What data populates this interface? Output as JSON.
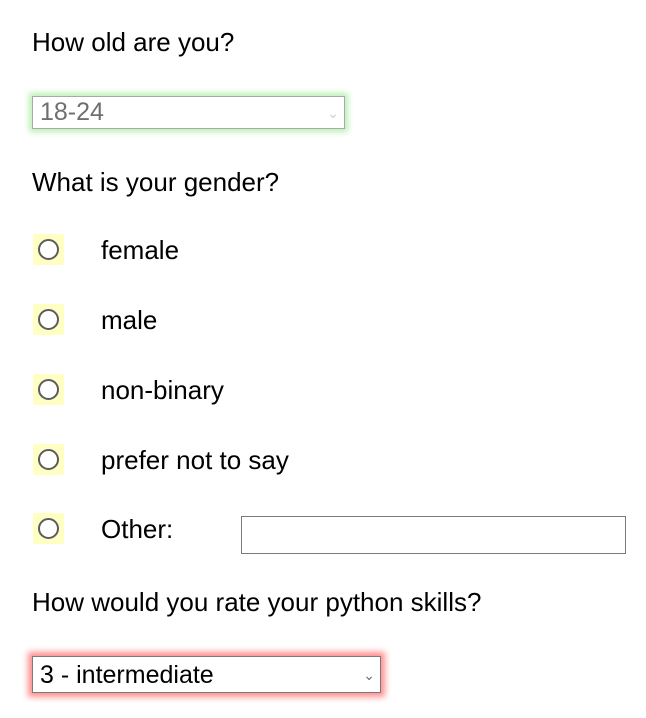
{
  "age_question": {
    "label": "How old are you?",
    "selected": "18-24",
    "highlight_color": "#b9f0b4"
  },
  "gender_question": {
    "label": "What is your gender?",
    "options": [
      {
        "label": "female",
        "checked": false
      },
      {
        "label": "male",
        "checked": false
      },
      {
        "label": "non-binary",
        "checked": false
      },
      {
        "label": "prefer not to say",
        "checked": false
      },
      {
        "label": "Other:",
        "checked": false
      }
    ],
    "other_value": "",
    "radio_highlight_color": "#ffffc4"
  },
  "python_question": {
    "label": "How would you rate your python skills?",
    "selected": "3 - intermediate",
    "highlight_color": "#ff8e8e"
  },
  "icons": {
    "dropdown": "chevron-down-icon",
    "radio": "radio-unchecked-icon"
  }
}
